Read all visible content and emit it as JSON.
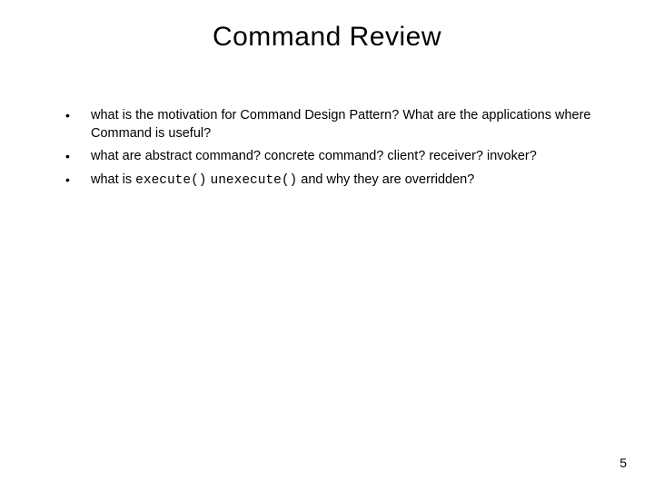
{
  "title": "Command Review",
  "bullets": [
    {
      "text": "what is the motivation for Command Design Pattern? What are the applications where Command is useful?"
    },
    {
      "text": "what are abstract command? concrete command? client? receiver? invoker?"
    },
    {
      "prefix": "what is ",
      "code1": "execute()",
      "mid": " ",
      "code2": "unexecute()",
      "suffix": " and why they are overridden?"
    }
  ],
  "page_number": "5"
}
